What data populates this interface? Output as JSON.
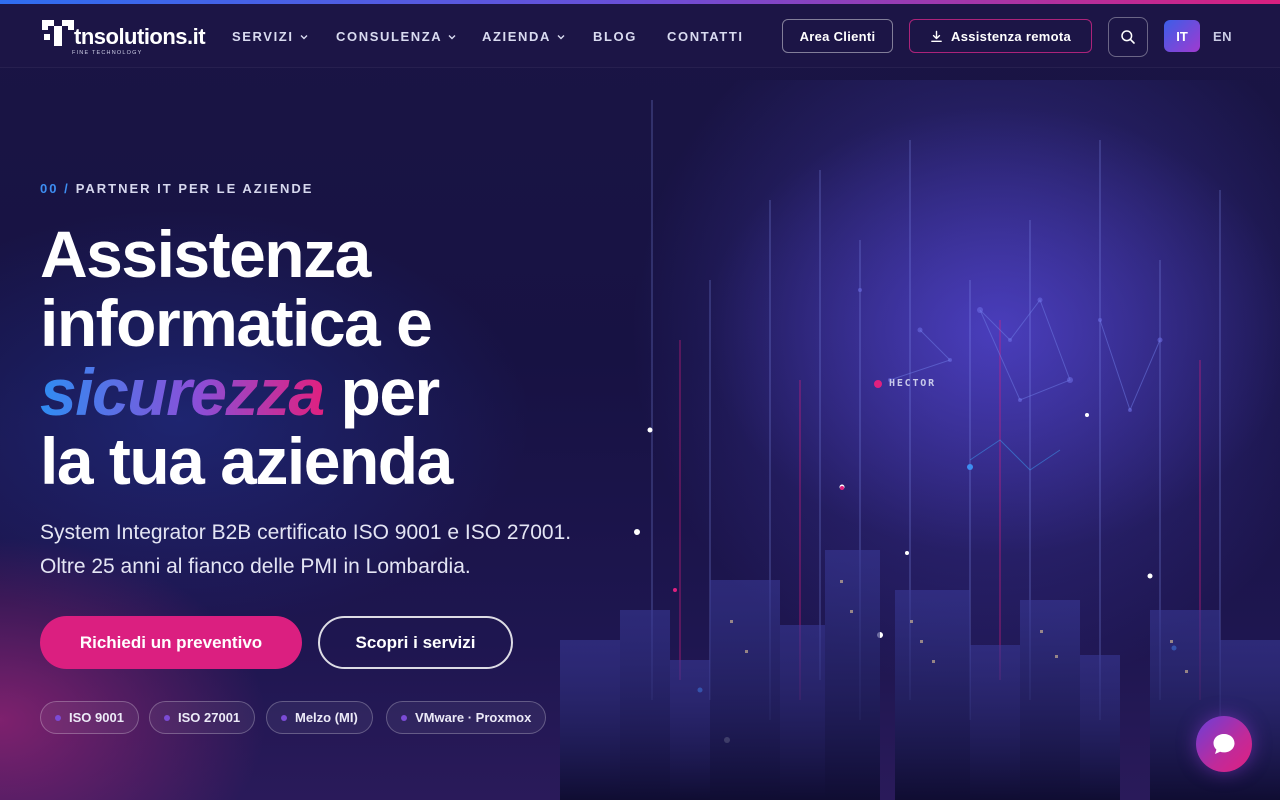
{
  "header": {
    "logo": {
      "name": "tnsolutions.it",
      "tagline": "FINE TECHNOLOGY"
    },
    "nav": [
      {
        "label": "SERVIZI",
        "has_dropdown": true
      },
      {
        "label": "CONSULENZA",
        "has_dropdown": true
      },
      {
        "label": "AZIENDA",
        "has_dropdown": true
      },
      {
        "label": "BLOG",
        "has_dropdown": false
      },
      {
        "label": "CONTATTI",
        "has_dropdown": false
      }
    ],
    "area_clienti": "Area Clienti",
    "assistenza_remota": "Assistenza remota",
    "languages": {
      "active": "IT",
      "other": "EN"
    }
  },
  "hero": {
    "eyebrow_number": "00 /",
    "eyebrow_text": "PARTNER IT PER LE AZIENDE",
    "headline_line1": "Assistenza",
    "headline_line2": "informatica e",
    "headline_accent": "sicurezza",
    "headline_line3_rest": "per",
    "headline_line4": "la tua azienda",
    "lead": "System Integrator B2B certificato ISO 9001 e ISO 27001. Oltre 25 anni al fianco delle PMI in Lombardia.",
    "cta_primary": "Richiedi un preventivo",
    "cta_secondary": "Scopri i servizi",
    "badges": [
      "ISO 9001",
      "ISO 27001",
      "Melzo (MI)",
      "VMware · Proxmox"
    ],
    "overlay_label": "HECTOR"
  },
  "icons": [
    "logo-mark",
    "chevron-down-icon",
    "download-icon",
    "search-icon",
    "chat-bubble-icon"
  ],
  "colors": {
    "accent_pink": "#db1f80",
    "accent_blue": "#3d8ef2",
    "accent_purple": "#7b4bd6",
    "background": "#171243"
  }
}
